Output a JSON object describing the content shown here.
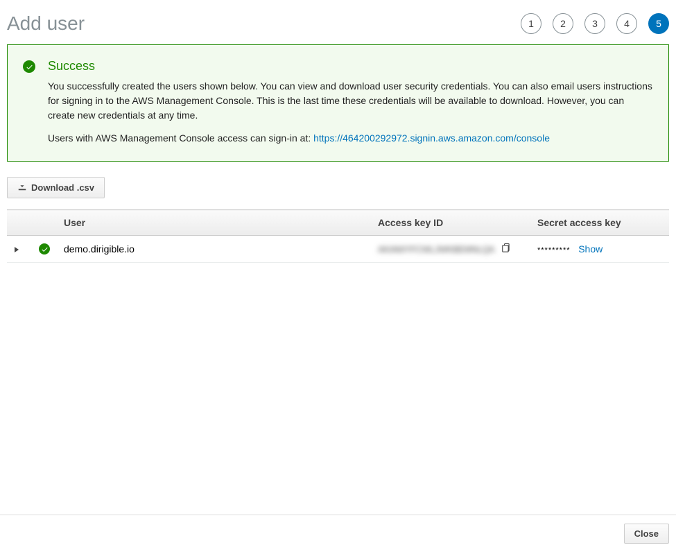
{
  "header": {
    "title": "Add user",
    "steps": [
      {
        "label": "1",
        "active": false
      },
      {
        "label": "2",
        "active": false
      },
      {
        "label": "3",
        "active": false
      },
      {
        "label": "4",
        "active": false
      },
      {
        "label": "5",
        "active": true
      }
    ]
  },
  "alert": {
    "title": "Success",
    "body1": "You successfully created the users shown below. You can view and download user security credentials. You can also email users instructions for signing in to the AWS Management Console. This is the last time these credentials will be available to download. However, you can create new credentials at any time.",
    "body2_prefix": "Users with AWS Management Console access can sign-in at: ",
    "body2_link": "https://464200292972.signin.aws.amazon.com/console"
  },
  "buttons": {
    "download_csv": "Download .csv",
    "close": "Close"
  },
  "table": {
    "headers": {
      "user": "User",
      "access_key_id": "Access key ID",
      "secret": "Secret access key"
    },
    "rows": [
      {
        "username": "demo.dirigible.io",
        "access_key_id_blur": "AKIAWYFCWLJWKBEMNLQA",
        "secret_mask": "*********",
        "show_label": "Show"
      }
    ]
  }
}
